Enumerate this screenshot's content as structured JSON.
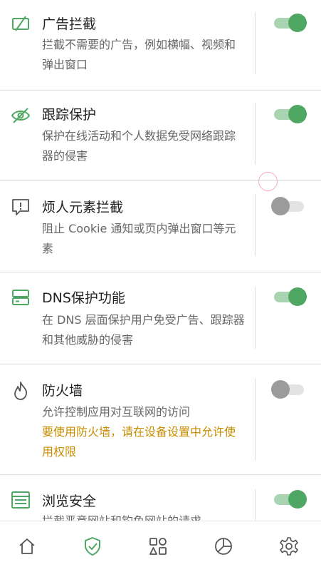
{
  "items": [
    {
      "title": "广告拦截",
      "description": "拦截不需要的广告，例如横幅、视频和弹出窗口",
      "icon": "ad-block-icon",
      "enabled": true
    },
    {
      "title": "跟踪保护",
      "description": "保护在线活动和个人数据免受网络跟踪器的侵害",
      "icon": "eye-off-icon",
      "enabled": true
    },
    {
      "title": "烦人元素拦截",
      "description": "阻止 Cookie 通知或页内弹出窗口等元素",
      "icon": "annoyance-icon",
      "enabled": false
    },
    {
      "title": "DNS保护功能",
      "description": "在 DNS 层面保护用户免受广告、跟踪器和其他威胁的侵害",
      "icon": "dns-server-icon",
      "enabled": true
    },
    {
      "title": "防火墙",
      "description": "允许控制应用对互联网的访问",
      "warning": "要使用防火墙，请在设备设置中允许使用权限",
      "icon": "flame-icon",
      "enabled": false
    },
    {
      "title": "浏览安全",
      "description": "拦截恶意网站和钓鱼网站的请求",
      "icon": "browser-window-icon",
      "enabled": true
    }
  ],
  "nav": [
    {
      "icon": "home-icon",
      "active": false
    },
    {
      "icon": "shield-check-icon",
      "active": true
    },
    {
      "icon": "apps-icon",
      "active": false
    },
    {
      "icon": "stats-pie-icon",
      "active": false
    },
    {
      "icon": "settings-gear-icon",
      "active": false
    }
  ],
  "colors": {
    "accent": "#4ea863",
    "warning": "#c98c00",
    "icon_green": "#4ea863",
    "icon_gray": "#555555"
  }
}
